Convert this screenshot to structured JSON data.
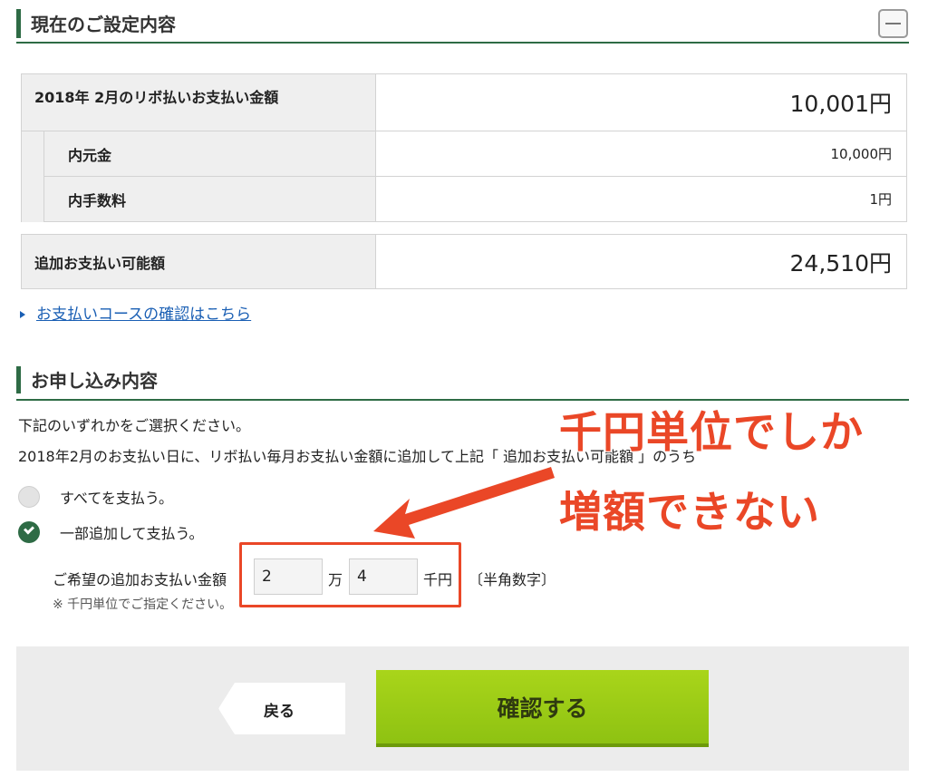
{
  "current_settings": {
    "title": "現在のご設定内容",
    "collapse_icon": "minus-icon"
  },
  "summary": {
    "payment_label": "2018年 2月のリボ払いお支払い金額",
    "payment_value": "10,001円",
    "principal_label": "内元金",
    "principal_value": "10,000円",
    "fee_label": "内手数料",
    "fee_value": "1円",
    "additional_label": "追加お支払い可能額",
    "additional_value": "24,510円"
  },
  "course_link": "お支払いコースの確認はこちら",
  "application": {
    "title": "お申し込み内容",
    "instruction": "下記のいずれかをご選択ください。",
    "description": "2018年2月のお支払い日に、リボ払い毎月お支払い金額に追加して上記「 追加お支払い可能額 」のうち",
    "option_all": "すべてを支払う。",
    "option_partial": "一部追加して支払う。",
    "selected_option": "option_partial",
    "amount_label": "ご希望の追加お支払い金額",
    "man_value": "2",
    "man_unit": "万",
    "sen_value": "4",
    "sen_unit": "千円",
    "hint": "〔半角数字〕",
    "note": "※ 千円単位でご指定ください。"
  },
  "annotation": {
    "line1": "千円単位でしか",
    "line2": "増額できない",
    "color": "#ea4727"
  },
  "buttons": {
    "back": "戻る",
    "confirm": "確認する"
  },
  "colors": {
    "brand_green": "#2e6b45",
    "confirm_green": "#8ec212",
    "link_blue": "#1a5fb4"
  }
}
